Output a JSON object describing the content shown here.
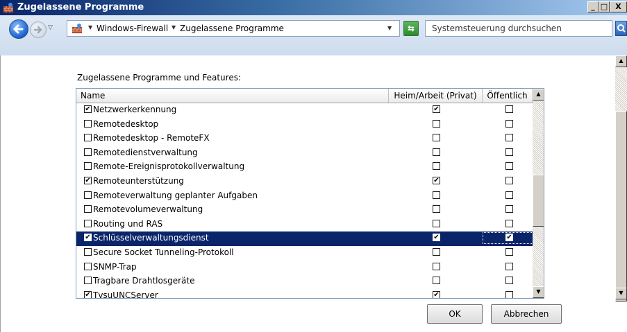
{
  "window": {
    "title": "Zugelassene Programme"
  },
  "address_bar": {
    "breadcrumbs": [
      "Windows-Firewall",
      "Zugelassene Programme"
    ]
  },
  "search": {
    "placeholder": "Systemsteuerung durchsuchen"
  },
  "main": {
    "section_label": "Zugelassene Programme und Features:",
    "columns": [
      "Name",
      "Heim/Arbeit (Privat)",
      "Öffentlich"
    ],
    "rows": [
      {
        "name": "Netzwerkerkennung",
        "enabled": true,
        "home": true,
        "public": false
      },
      {
        "name": "Remotedesktop",
        "enabled": false,
        "home": false,
        "public": false
      },
      {
        "name": "Remotedesktop - RemoteFX",
        "enabled": false,
        "home": false,
        "public": false
      },
      {
        "name": "Remotedienstverwaltung",
        "enabled": false,
        "home": false,
        "public": false
      },
      {
        "name": "Remote-Ereignisprotokollverwaltung",
        "enabled": false,
        "home": false,
        "public": false
      },
      {
        "name": "Remoteunterstützung",
        "enabled": true,
        "home": true,
        "public": false
      },
      {
        "name": "Remoteverwaltung geplanter Aufgaben",
        "enabled": false,
        "home": false,
        "public": false
      },
      {
        "name": "Remotevolumeverwaltung",
        "enabled": false,
        "home": false,
        "public": false
      },
      {
        "name": "Routing und RAS",
        "enabled": false,
        "home": false,
        "public": false
      },
      {
        "name": "Schlüsselverwaltungsdienst",
        "enabled": true,
        "home": true,
        "public": true,
        "selected": true
      },
      {
        "name": "Secure Socket Tunneling-Protokoll",
        "enabled": false,
        "home": false,
        "public": false
      },
      {
        "name": "SNMP-Trap",
        "enabled": false,
        "home": false,
        "public": false
      },
      {
        "name": "Tragbare Drahtlosgeräte",
        "enabled": false,
        "home": false,
        "public": false
      },
      {
        "name": "TvsuUNCServer",
        "enabled": true,
        "home": true,
        "public": false
      }
    ]
  },
  "buttons": {
    "ok": "OK",
    "cancel": "Abbrechen"
  },
  "colors": {
    "selection": "#0a246a",
    "titlebar": "#0a246a"
  },
  "icons": [
    "firewall-icon",
    "back-arrow-icon",
    "forward-arrow-icon",
    "refresh-icon",
    "search-icon"
  ]
}
